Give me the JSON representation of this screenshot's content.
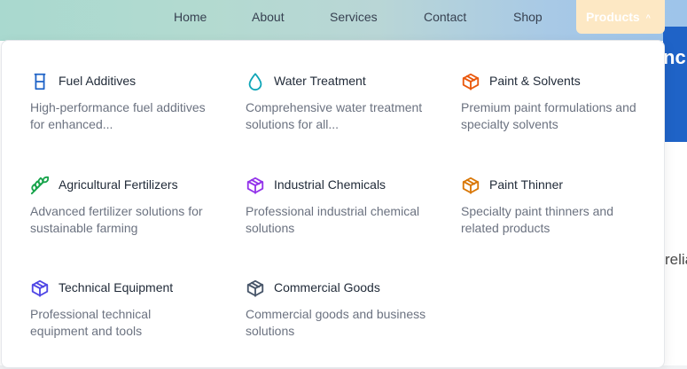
{
  "nav": {
    "items": [
      {
        "label": "Home"
      },
      {
        "label": "About"
      },
      {
        "label": "Services"
      },
      {
        "label": "Contact"
      },
      {
        "label": "Shop"
      }
    ],
    "products_label": "Products",
    "products_chevron": "^"
  },
  "background": {
    "blue_text": "nc",
    "side_text": "relia"
  },
  "menu": {
    "items": [
      {
        "title": "Fuel Additives",
        "desc": "High-performance fuel additives for enhanced...",
        "icon": "fuel-can-icon",
        "color": "#1f63c7"
      },
      {
        "title": "Water Treatment",
        "desc": "Comprehensive water treatment solutions for all...",
        "icon": "droplet-icon",
        "color": "#0ea5b7"
      },
      {
        "title": "Paint & Solvents",
        "desc": "Premium paint formulations and specialty solvents",
        "icon": "box-icon",
        "color": "#ea580c"
      },
      {
        "title": "Agricultural Fertilizers",
        "desc": "Advanced fertilizer solutions for sustainable farming",
        "icon": "wheat-icon",
        "color": "#16a34a"
      },
      {
        "title": "Industrial Chemicals",
        "desc": "Professional industrial chemical solutions",
        "icon": "box-icon",
        "color": "#9333ea"
      },
      {
        "title": "Paint Thinner",
        "desc": "Specialty paint thinners and related products",
        "icon": "box-icon",
        "color": "#d97706"
      },
      {
        "title": "Technical Equipment",
        "desc": "Professional technical equipment and tools",
        "icon": "box-icon",
        "color": "#4f46e5"
      },
      {
        "title": "Commercial Goods",
        "desc": "Commercial goods and business solutions",
        "icon": "box-icon",
        "color": "#475569"
      }
    ]
  }
}
